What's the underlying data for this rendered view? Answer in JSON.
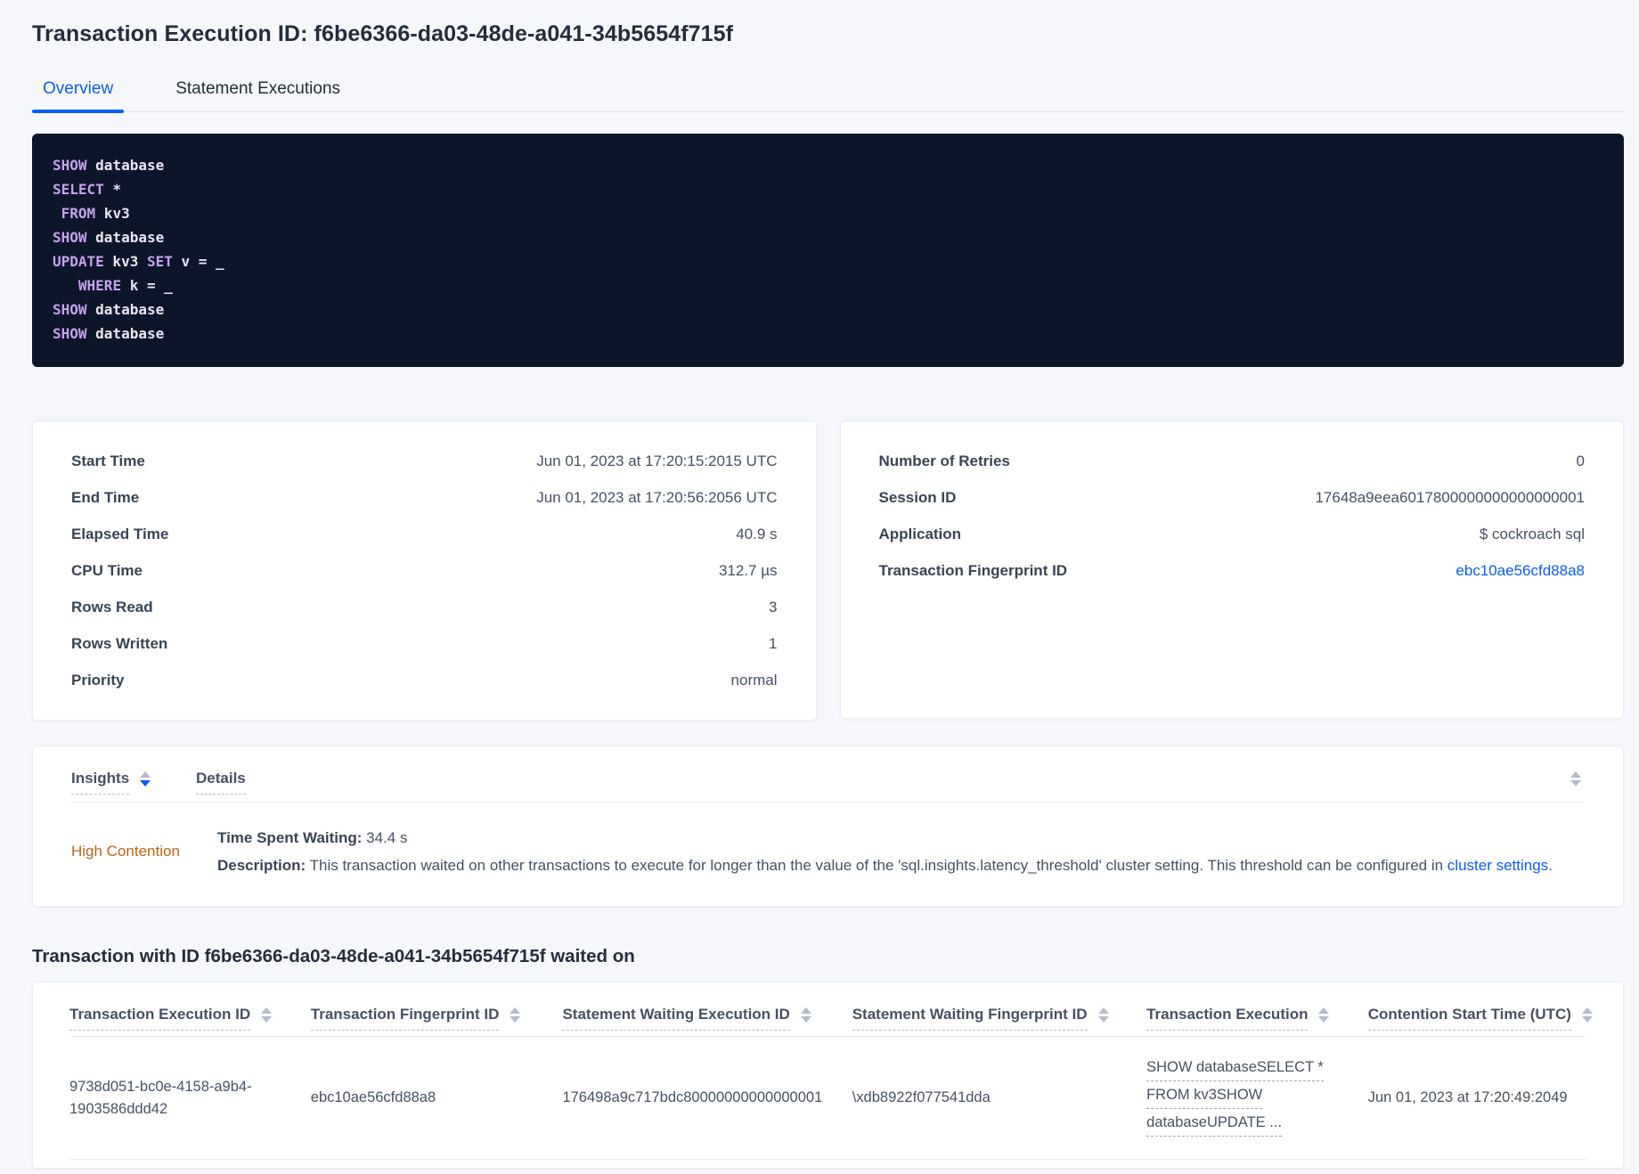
{
  "page": {
    "title": "Transaction Execution ID: f6be6366-da03-48de-a041-34b5654f715f"
  },
  "tabs": [
    {
      "label": "Overview",
      "active": true
    },
    {
      "label": "Statement Executions",
      "active": false
    }
  ],
  "colors": {
    "accent_blue": "#0a5ef2",
    "insight_orange": "#bf6315",
    "code_background": "#0d1628",
    "code_keyword": "#c5a1ec",
    "page_background": "#f5f7fa"
  },
  "icons": {
    "sort": "up-down-triangles"
  },
  "sql": {
    "lines": [
      {
        "parts": [
          {
            "t": "SHOW"
          },
          {
            "t": " database"
          }
        ]
      },
      {
        "parts": [
          {
            "t": "SELECT"
          },
          {
            "t": " *"
          }
        ]
      },
      {
        "parts": [
          {
            "t": " "
          },
          {
            "t": "FROM"
          },
          {
            "t": " kv3"
          }
        ]
      },
      {
        "parts": [
          {
            "t": "SHOW"
          },
          {
            "t": " database"
          }
        ]
      },
      {
        "parts": [
          {
            "t": "UPDATE"
          },
          {
            "t": " kv3 "
          },
          {
            "t": "SET"
          },
          {
            "t": " v = _"
          }
        ]
      },
      {
        "parts": [
          {
            "t": "   "
          },
          {
            "t": "WHERE"
          },
          {
            "t": " k = _"
          }
        ]
      },
      {
        "parts": [
          {
            "t": "SHOW"
          },
          {
            "t": " database"
          }
        ]
      },
      {
        "parts": [
          {
            "t": "SHOW"
          },
          {
            "t": " database"
          }
        ]
      }
    ]
  },
  "left_card": {
    "rows": [
      {
        "label": "Start Time",
        "value": "Jun 01, 2023 at 17:20:15:2015 UTC"
      },
      {
        "label": "End Time",
        "value": "Jun 01, 2023 at 17:20:56:2056 UTC"
      },
      {
        "label": "Elapsed Time",
        "value": "40.9 s"
      },
      {
        "label": "CPU Time",
        "value": "312.7 µs"
      },
      {
        "label": "Rows Read",
        "value": "3"
      },
      {
        "label": "Rows Written",
        "value": "1"
      },
      {
        "label": "Priority",
        "value": "normal"
      }
    ]
  },
  "right_card": {
    "rows": [
      {
        "label": "Number of Retries",
        "value": "0"
      },
      {
        "label": "Session ID",
        "value": "17648a9eea6017800000000000000001"
      },
      {
        "label": "Application",
        "value": "$ cockroach sql"
      }
    ],
    "fingerprint_row": {
      "label": "Transaction Fingerprint ID",
      "value": "ebc10ae56cfd88a8"
    }
  },
  "insights": {
    "col1_header": "Insights",
    "col2_header": "Details",
    "row": {
      "insight": "High Contention",
      "waiting_label": "Time Spent Waiting:",
      "waiting_value": " 34.4 s",
      "description_label": "Description:",
      "description_text": " This transaction waited on other transactions to execute for longer than the value of the 'sql.insights.latency_threshold' cluster setting. This threshold can be configured in ",
      "description_link": "cluster settings",
      "description_suffix": "."
    }
  },
  "waited_on": {
    "heading": "Transaction with ID f6be6366-da03-48de-a041-34b5654f715f waited on",
    "columns": [
      "Transaction Execution ID",
      "Transaction Fingerprint ID",
      "Statement Waiting Execution ID",
      "Statement Waiting Fingerprint ID",
      "Transaction Execution",
      "Contention Start Time (UTC)"
    ],
    "row": {
      "transaction_execution_id": "9738d051-bc0e-4158-a9b4-1903586ddd42",
      "transaction_fingerprint_id": "ebc10ae56cfd88a8",
      "statement_waiting_execution_id": "176498a9c717bdc80000000000000001",
      "statement_waiting_fingerprint_id": "\\xdb8922f077541dda",
      "transaction_execution_lines": [
        "SHOW databaseSELECT *",
        "FROM kv3SHOW",
        "databaseUPDATE ..."
      ],
      "contention_start_time": "Jun 01, 2023 at 17:20:49:2049"
    }
  }
}
